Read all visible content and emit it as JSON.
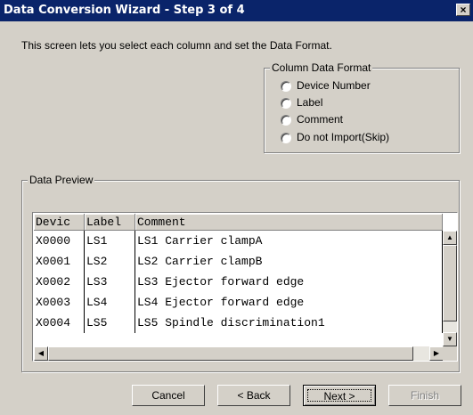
{
  "window": {
    "title": "Data Conversion Wizard - Step 3 of 4",
    "close_label": "×"
  },
  "intro_text": "This screen lets you select each column and set the Data Format.",
  "column_data_format": {
    "legend": "Column Data Format",
    "options": [
      "Device Number",
      "Label",
      "Comment",
      "Do not Import(Skip)"
    ]
  },
  "data_preview": {
    "legend": "Data Preview",
    "columns": [
      "Devic",
      "Label",
      "Comment"
    ],
    "rows": [
      [
        "X0000",
        "LS1",
        "LS1 Carrier clampA"
      ],
      [
        "X0001",
        "LS2",
        "LS2 Carrier clampB"
      ],
      [
        "X0002",
        "LS3",
        "LS3 Ejector forward edge"
      ],
      [
        "X0003",
        "LS4",
        "LS4 Ejector forward edge"
      ],
      [
        "X0004",
        "LS5",
        "LS5 Spindle discrimination1"
      ]
    ]
  },
  "buttons": {
    "cancel": "Cancel",
    "back": "< Back",
    "next": "Next >",
    "finish": "Finish"
  },
  "icons": {
    "close": "close-icon",
    "scroll_up": "arrow-up-icon",
    "scroll_down": "arrow-down-icon",
    "scroll_left": "arrow-left-icon",
    "scroll_right": "arrow-right-icon"
  },
  "colors": {
    "titlebar": "#0a246a",
    "dialog_bg": "#d4d0c8"
  }
}
